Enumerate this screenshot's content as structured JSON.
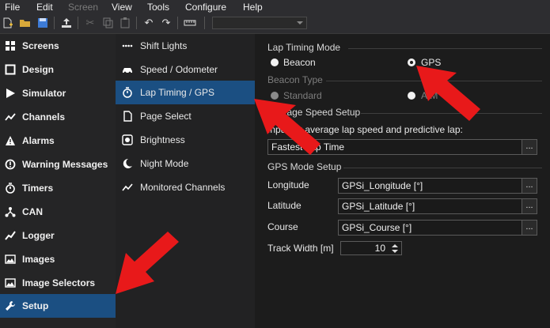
{
  "menu": [
    "File",
    "Edit",
    "Screen",
    "View",
    "Tools",
    "Configure",
    "Help"
  ],
  "sidebar": {
    "items": [
      {
        "label": "Screens",
        "icon": "grid-icon"
      },
      {
        "label": "Design",
        "icon": "square-icon"
      },
      {
        "label": "Simulator",
        "icon": "play-icon"
      },
      {
        "label": "Channels",
        "icon": "chart-line-icon"
      },
      {
        "label": "Alarms",
        "icon": "warning-icon"
      },
      {
        "label": "Warning Messages",
        "icon": "alert-circle-icon"
      },
      {
        "label": "Timers",
        "icon": "stopwatch-icon"
      },
      {
        "label": "CAN",
        "icon": "network-icon"
      },
      {
        "label": "Logger",
        "icon": "trend-icon"
      },
      {
        "label": "Images",
        "icon": "image-icon"
      },
      {
        "label": "Image Selectors",
        "icon": "image-stack-icon"
      },
      {
        "label": "Setup",
        "icon": "wrench-icon"
      }
    ],
    "selected": "Setup"
  },
  "subnav": {
    "items": [
      {
        "label": "Shift Lights",
        "icon": "dots-icon"
      },
      {
        "label": "Speed / Odometer",
        "icon": "car-icon"
      },
      {
        "label": "Lap Timing / GPS",
        "icon": "stopwatch-icon"
      },
      {
        "label": "Page Select",
        "icon": "page-icon"
      },
      {
        "label": "Brightness",
        "icon": "brightness-icon"
      },
      {
        "label": "Night Mode",
        "icon": "moon-icon"
      },
      {
        "label": "Monitored Channels",
        "icon": "chart-line-icon"
      }
    ],
    "selected": "Lap Timing / GPS"
  },
  "lap_timing_mode": {
    "title": "Lap Timing Mode",
    "options": [
      "Beacon",
      "GPS"
    ],
    "selected": "GPS"
  },
  "beacon_type": {
    "title": "Beacon Type",
    "options": [
      "Standard",
      "AIM"
    ]
  },
  "average_speed": {
    "title": "Average Speed Setup",
    "prompt": "Input for average lap speed and predictive lap:",
    "value": "Fastest Lap Time"
  },
  "gps_mode": {
    "title": "GPS Mode Setup",
    "longitude_label": "Longitude",
    "longitude_value": "GPSi_Longitude [°]",
    "latitude_label": "Latitude",
    "latitude_value": "GPSi_Latitude [°]",
    "course_label": "Course",
    "course_value": "GPSi_Course [°]",
    "track_width_label": "Track Width [m]",
    "track_width_value": "10"
  },
  "browse_button_label": "...",
  "colors": {
    "accent": "#1b4f82",
    "arrow": "#e8191a",
    "background": "#1e1e1e"
  }
}
